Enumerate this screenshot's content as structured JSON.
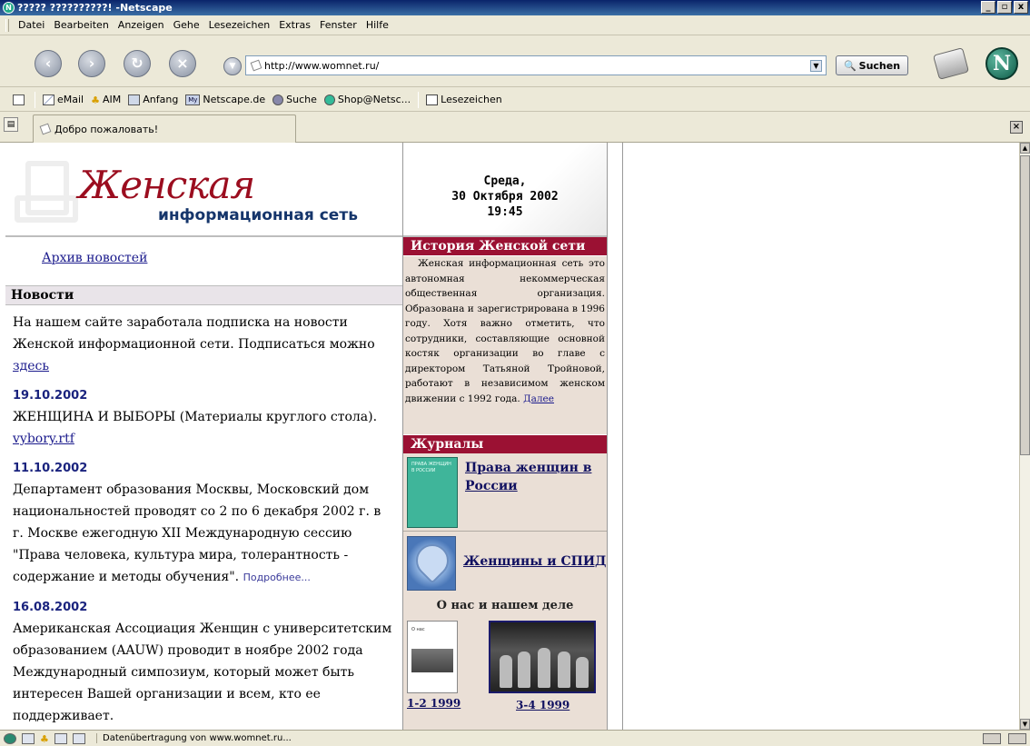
{
  "window": {
    "title": "????? ??????????! -Netscape",
    "controls": [
      "_",
      "▫",
      "x"
    ]
  },
  "menu": [
    "Datei",
    "Bearbeiten",
    "Anzeigen",
    "Gehe",
    "Lesezeichen",
    "Extras",
    "Fenster",
    "Hilfe"
  ],
  "nav": {
    "url": "http://www.womnet.ru/",
    "search_label": "Suchen"
  },
  "personal_toolbar": [
    {
      "label": "eMail",
      "icon": "mail-icon"
    },
    {
      "label": "AIM",
      "icon": "aim-icon"
    },
    {
      "label": "Anfang",
      "icon": "home-icon"
    },
    {
      "label": "Netscape.de",
      "icon": "my-netscape-icon"
    },
    {
      "label": "Suche",
      "icon": "search-icon"
    },
    {
      "label": "Shop@Netsc...",
      "icon": "shop-icon"
    },
    {
      "label": "Lesezeichen",
      "icon": "bookmarks-folder-icon"
    }
  ],
  "tab": {
    "title": "Добро пожаловать!"
  },
  "page": {
    "logo_script": "Женская",
    "logo_sub": "информационная сеть",
    "date_line1": "Среда,",
    "date_line2": "30 Октября 2002",
    "time": "19:45",
    "archive_link": "Архив новостей",
    "news_heading": "Новости",
    "news_intro": "На нашем сайте заработала подписка на новости Женской информационной сети. Подписаться можно",
    "news_intro_link": "здесь",
    "news": [
      {
        "date": "19.10.2002",
        "text": "ЖЕНЩИНА И ВЫБОРЫ (Материалы круглого стола).",
        "link": "vybory.rtf"
      },
      {
        "date": "11.10.2002",
        "text": "Департамент образования Москвы, Московский дом национальностей проводят со 2 по 6 декабря 2002 г. в г. Москве ежегодную XII Международную сессию \"Права человека, культура мира, толерантность - содержание и методы обучения\".",
        "link": "Подробнее..."
      },
      {
        "date": "16.08.2002",
        "text": "Американская Ассоциация Женщин с университетским образованием (AAUW) проводит в ноябре 2002 года Международный симпозиум, который может быть интересен Вашей организации и всем, кто ее поддерживает.",
        "link": ""
      }
    ],
    "history_heading": "История Женской сети",
    "history_text": "Женская информационная сеть это автономная некоммерческая общественная организация. Образована и зарегистрирована в 1996 году. Хотя важно отметить, что сотрудники, составляющие основной костяк организации во главе с директором Татьяной Тройновой, работают в независимом женском движении с 1992 года.",
    "history_link": "Далее",
    "journals_heading": "Журналы",
    "journal1": "Права женщин в России",
    "journal2": "Женщины и СПИД",
    "about_title": "О нас и нашем деле",
    "issue1": "1-2 1999",
    "issue2": "3-4 1999"
  },
  "status": {
    "text": "Datenübertragung von www.womnet.ru..."
  }
}
